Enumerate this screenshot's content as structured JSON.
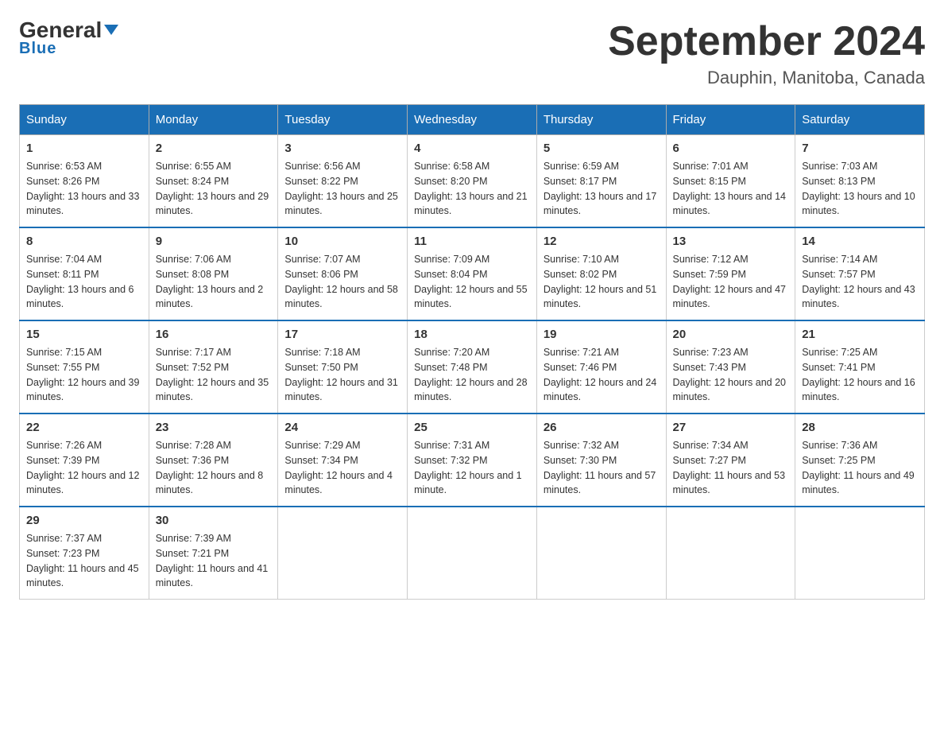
{
  "header": {
    "logo_general": "General",
    "logo_blue": "Blue",
    "month_title": "September 2024",
    "location": "Dauphin, Manitoba, Canada"
  },
  "days_of_week": [
    "Sunday",
    "Monday",
    "Tuesday",
    "Wednesday",
    "Thursday",
    "Friday",
    "Saturday"
  ],
  "weeks": [
    [
      {
        "day": "1",
        "sunrise": "6:53 AM",
        "sunset": "8:26 PM",
        "daylight": "13 hours and 33 minutes."
      },
      {
        "day": "2",
        "sunrise": "6:55 AM",
        "sunset": "8:24 PM",
        "daylight": "13 hours and 29 minutes."
      },
      {
        "day": "3",
        "sunrise": "6:56 AM",
        "sunset": "8:22 PM",
        "daylight": "13 hours and 25 minutes."
      },
      {
        "day": "4",
        "sunrise": "6:58 AM",
        "sunset": "8:20 PM",
        "daylight": "13 hours and 21 minutes."
      },
      {
        "day": "5",
        "sunrise": "6:59 AM",
        "sunset": "8:17 PM",
        "daylight": "13 hours and 17 minutes."
      },
      {
        "day": "6",
        "sunrise": "7:01 AM",
        "sunset": "8:15 PM",
        "daylight": "13 hours and 14 minutes."
      },
      {
        "day": "7",
        "sunrise": "7:03 AM",
        "sunset": "8:13 PM",
        "daylight": "13 hours and 10 minutes."
      }
    ],
    [
      {
        "day": "8",
        "sunrise": "7:04 AM",
        "sunset": "8:11 PM",
        "daylight": "13 hours and 6 minutes."
      },
      {
        "day": "9",
        "sunrise": "7:06 AM",
        "sunset": "8:08 PM",
        "daylight": "13 hours and 2 minutes."
      },
      {
        "day": "10",
        "sunrise": "7:07 AM",
        "sunset": "8:06 PM",
        "daylight": "12 hours and 58 minutes."
      },
      {
        "day": "11",
        "sunrise": "7:09 AM",
        "sunset": "8:04 PM",
        "daylight": "12 hours and 55 minutes."
      },
      {
        "day": "12",
        "sunrise": "7:10 AM",
        "sunset": "8:02 PM",
        "daylight": "12 hours and 51 minutes."
      },
      {
        "day": "13",
        "sunrise": "7:12 AM",
        "sunset": "7:59 PM",
        "daylight": "12 hours and 47 minutes."
      },
      {
        "day": "14",
        "sunrise": "7:14 AM",
        "sunset": "7:57 PM",
        "daylight": "12 hours and 43 minutes."
      }
    ],
    [
      {
        "day": "15",
        "sunrise": "7:15 AM",
        "sunset": "7:55 PM",
        "daylight": "12 hours and 39 minutes."
      },
      {
        "day": "16",
        "sunrise": "7:17 AM",
        "sunset": "7:52 PM",
        "daylight": "12 hours and 35 minutes."
      },
      {
        "day": "17",
        "sunrise": "7:18 AM",
        "sunset": "7:50 PM",
        "daylight": "12 hours and 31 minutes."
      },
      {
        "day": "18",
        "sunrise": "7:20 AM",
        "sunset": "7:48 PM",
        "daylight": "12 hours and 28 minutes."
      },
      {
        "day": "19",
        "sunrise": "7:21 AM",
        "sunset": "7:46 PM",
        "daylight": "12 hours and 24 minutes."
      },
      {
        "day": "20",
        "sunrise": "7:23 AM",
        "sunset": "7:43 PM",
        "daylight": "12 hours and 20 minutes."
      },
      {
        "day": "21",
        "sunrise": "7:25 AM",
        "sunset": "7:41 PM",
        "daylight": "12 hours and 16 minutes."
      }
    ],
    [
      {
        "day": "22",
        "sunrise": "7:26 AM",
        "sunset": "7:39 PM",
        "daylight": "12 hours and 12 minutes."
      },
      {
        "day": "23",
        "sunrise": "7:28 AM",
        "sunset": "7:36 PM",
        "daylight": "12 hours and 8 minutes."
      },
      {
        "day": "24",
        "sunrise": "7:29 AM",
        "sunset": "7:34 PM",
        "daylight": "12 hours and 4 minutes."
      },
      {
        "day": "25",
        "sunrise": "7:31 AM",
        "sunset": "7:32 PM",
        "daylight": "12 hours and 1 minute."
      },
      {
        "day": "26",
        "sunrise": "7:32 AM",
        "sunset": "7:30 PM",
        "daylight": "11 hours and 57 minutes."
      },
      {
        "day": "27",
        "sunrise": "7:34 AM",
        "sunset": "7:27 PM",
        "daylight": "11 hours and 53 minutes."
      },
      {
        "day": "28",
        "sunrise": "7:36 AM",
        "sunset": "7:25 PM",
        "daylight": "11 hours and 49 minutes."
      }
    ],
    [
      {
        "day": "29",
        "sunrise": "7:37 AM",
        "sunset": "7:23 PM",
        "daylight": "11 hours and 45 minutes."
      },
      {
        "day": "30",
        "sunrise": "7:39 AM",
        "sunset": "7:21 PM",
        "daylight": "11 hours and 41 minutes."
      },
      null,
      null,
      null,
      null,
      null
    ]
  ]
}
